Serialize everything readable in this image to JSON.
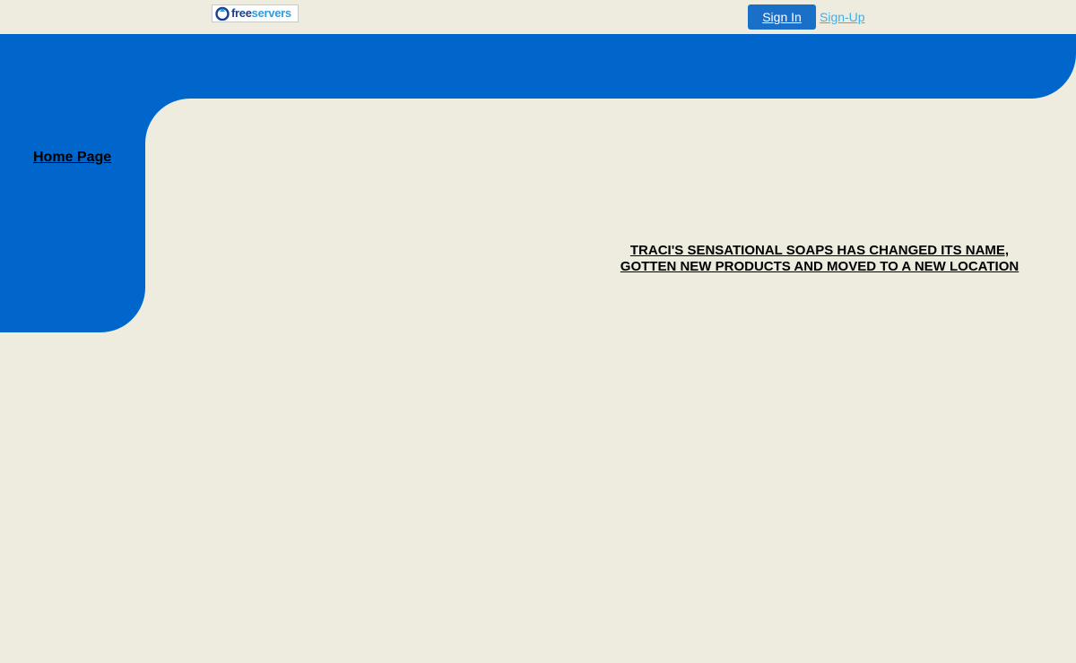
{
  "header": {
    "logo": {
      "icon": "freeservers-logo-icon",
      "text_free": "free",
      "text_servers": "servers"
    },
    "signin_label": "Sign In",
    "signup_label": "Sign-Up"
  },
  "sidebar": {
    "items": [
      {
        "label": "Home Page"
      }
    ]
  },
  "main": {
    "headline": "TRACI'S SENSATIONAL SOAPS HAS CHANGED ITS NAME, GOTTEN NEW PRODUCTS AND MOVED TO A NEW LOCATION"
  },
  "colors": {
    "background": "#edecdf",
    "frame_blue": "#0066cc",
    "signin_button": "#1a6fc9",
    "signup_link": "#41b0ea"
  }
}
